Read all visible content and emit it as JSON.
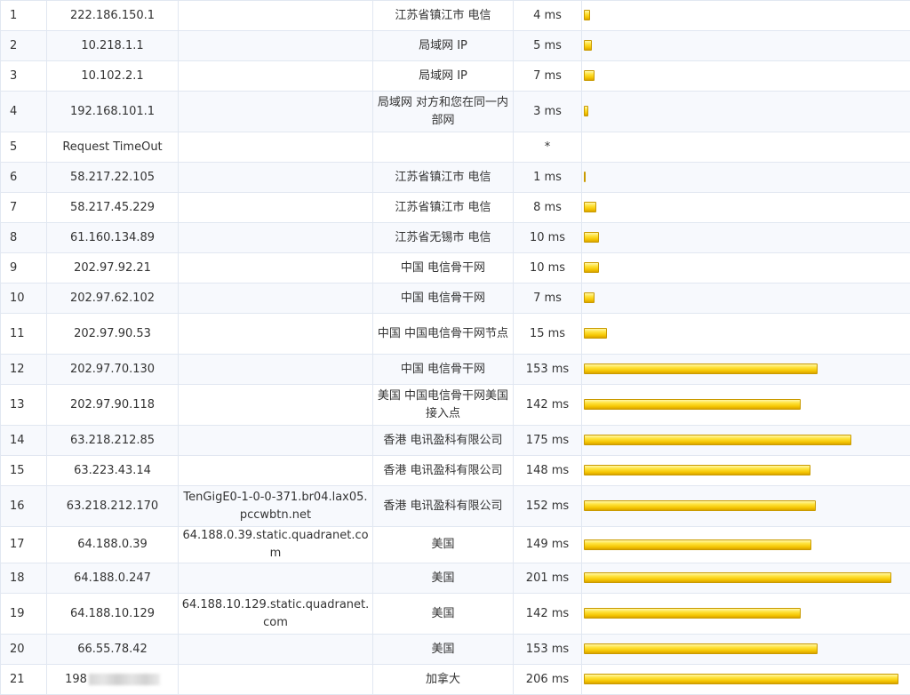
{
  "hops": [
    {
      "hop": "1",
      "ip": "222.186.150.1",
      "host": "",
      "location": "江苏省镇江市 电信",
      "time": "4 ms",
      "ms": 4
    },
    {
      "hop": "2",
      "ip": "10.218.1.1",
      "host": "",
      "location": "局域网 IP",
      "time": "5 ms",
      "ms": 5
    },
    {
      "hop": "3",
      "ip": "10.102.2.1",
      "host": "",
      "location": "局域网 IP",
      "time": "7 ms",
      "ms": 7
    },
    {
      "hop": "4",
      "ip": "192.168.101.1",
      "host": "",
      "location": "局域网 对方和您在同一内部网",
      "time": "3 ms",
      "ms": 3
    },
    {
      "hop": "5",
      "ip": "Request TimeOut",
      "host": "",
      "location": "",
      "time": "*",
      "ms": null
    },
    {
      "hop": "6",
      "ip": "58.217.22.105",
      "host": "",
      "location": "江苏省镇江市 电信",
      "time": "1 ms",
      "ms": 1
    },
    {
      "hop": "7",
      "ip": "58.217.45.229",
      "host": "",
      "location": "江苏省镇江市 电信",
      "time": "8 ms",
      "ms": 8
    },
    {
      "hop": "8",
      "ip": "61.160.134.89",
      "host": "",
      "location": "江苏省无锡市 电信",
      "time": "10 ms",
      "ms": 10
    },
    {
      "hop": "9",
      "ip": "202.97.92.21",
      "host": "",
      "location": "中国 电信骨干网",
      "time": "10 ms",
      "ms": 10
    },
    {
      "hop": "10",
      "ip": "202.97.62.102",
      "host": "",
      "location": "中国 电信骨干网",
      "time": "7 ms",
      "ms": 7
    },
    {
      "hop": "11",
      "ip": "202.97.90.53",
      "host": "",
      "location": "中国 中国电信骨干网节点",
      "time": "15 ms",
      "ms": 15
    },
    {
      "hop": "12",
      "ip": "202.97.70.130",
      "host": "",
      "location": "中国 电信骨干网",
      "time": "153 ms",
      "ms": 153
    },
    {
      "hop": "13",
      "ip": "202.97.90.118",
      "host": "",
      "location": "美国 中国电信骨干网美国接入点",
      "time": "142 ms",
      "ms": 142
    },
    {
      "hop": "14",
      "ip": "63.218.212.85",
      "host": "",
      "location": "香港 电讯盈科有限公司",
      "time": "175 ms",
      "ms": 175
    },
    {
      "hop": "15",
      "ip": "63.223.43.14",
      "host": "",
      "location": "香港 电讯盈科有限公司",
      "time": "148 ms",
      "ms": 148
    },
    {
      "hop": "16",
      "ip": "63.218.212.170",
      "host": "TenGigE0-1-0-0-371.br04.lax05.pccwbtn.net",
      "location": "香港 电讯盈科有限公司",
      "time": "152 ms",
      "ms": 152
    },
    {
      "hop": "17",
      "ip": "64.188.0.39",
      "host": "64.188.0.39.static.quadranet.com",
      "location": "美国",
      "time": "149 ms",
      "ms": 149
    },
    {
      "hop": "18",
      "ip": "64.188.0.247",
      "host": "",
      "location": "美国",
      "time": "201 ms",
      "ms": 201
    },
    {
      "hop": "19",
      "ip": "64.188.10.129",
      "host": "64.188.10.129.static.quadranet.com",
      "location": "美国",
      "time": "142 ms",
      "ms": 142
    },
    {
      "hop": "20",
      "ip": "66.55.78.42",
      "host": "",
      "location": "美国",
      "time": "153 ms",
      "ms": 153
    },
    {
      "hop": "21",
      "ip": "198",
      "host": "",
      "location": "加拿大",
      "time": "206 ms",
      "ms": 206
    }
  ],
  "colors": {
    "bar_fill": "#f4c400",
    "bar_border": "#c99a00",
    "grid": "#e1e7f1"
  }
}
